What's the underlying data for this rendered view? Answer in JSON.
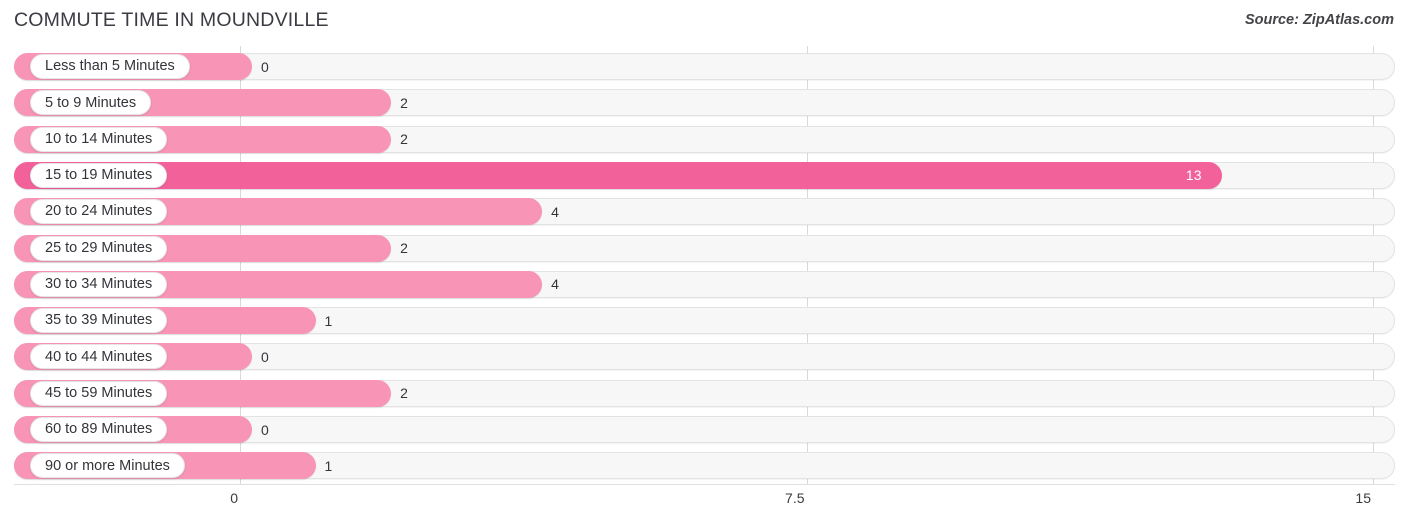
{
  "header": {
    "title": "COMMUTE TIME IN MOUNDVILLE",
    "source": "Source: ZipAtlas.com"
  },
  "colors": {
    "bar": "#f894b5",
    "bar_highlight": "#f2619a",
    "track": "#f7f7f7",
    "gridline": "#d9d9d9",
    "text": "#33333a"
  },
  "chart_data": {
    "type": "bar",
    "orientation": "horizontal",
    "title": "COMMUTE TIME IN MOUNDVILLE",
    "xlabel": "",
    "ylabel": "",
    "xlim": [
      0,
      15
    ],
    "xticks": [
      "0",
      "7.5",
      "15"
    ],
    "xtick_values": [
      0,
      7.5,
      15
    ],
    "grid": true,
    "legend": false,
    "categories": [
      "Less than 5 Minutes",
      "5 to 9 Minutes",
      "10 to 14 Minutes",
      "15 to 19 Minutes",
      "20 to 24 Minutes",
      "25 to 29 Minutes",
      "30 to 34 Minutes",
      "35 to 39 Minutes",
      "40 to 44 Minutes",
      "45 to 59 Minutes",
      "60 to 89 Minutes",
      "90 or more Minutes"
    ],
    "values": [
      0,
      2,
      2,
      13,
      4,
      2,
      4,
      1,
      0,
      2,
      0,
      1
    ],
    "value_labels": [
      "0",
      "2",
      "2",
      "13",
      "4",
      "2",
      "4",
      "1",
      "0",
      "2",
      "0",
      "1"
    ],
    "highlight_index": 3
  }
}
